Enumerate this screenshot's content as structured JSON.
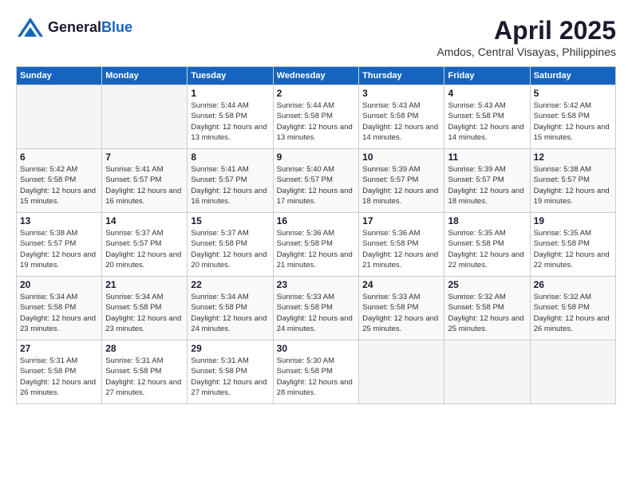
{
  "header": {
    "logo_general": "General",
    "logo_blue": "Blue",
    "month_title": "April 2025",
    "location": "Amdos, Central Visayas, Philippines"
  },
  "weekdays": [
    "Sunday",
    "Monday",
    "Tuesday",
    "Wednesday",
    "Thursday",
    "Friday",
    "Saturday"
  ],
  "weeks": [
    [
      {
        "day": "",
        "sunrise": "",
        "sunset": "",
        "daylight": ""
      },
      {
        "day": "",
        "sunrise": "",
        "sunset": "",
        "daylight": ""
      },
      {
        "day": "1",
        "sunrise": "Sunrise: 5:44 AM",
        "sunset": "Sunset: 5:58 PM",
        "daylight": "Daylight: 12 hours and 13 minutes."
      },
      {
        "day": "2",
        "sunrise": "Sunrise: 5:44 AM",
        "sunset": "Sunset: 5:58 PM",
        "daylight": "Daylight: 12 hours and 13 minutes."
      },
      {
        "day": "3",
        "sunrise": "Sunrise: 5:43 AM",
        "sunset": "Sunset: 5:58 PM",
        "daylight": "Daylight: 12 hours and 14 minutes."
      },
      {
        "day": "4",
        "sunrise": "Sunrise: 5:43 AM",
        "sunset": "Sunset: 5:58 PM",
        "daylight": "Daylight: 12 hours and 14 minutes."
      },
      {
        "day": "5",
        "sunrise": "Sunrise: 5:42 AM",
        "sunset": "Sunset: 5:58 PM",
        "daylight": "Daylight: 12 hours and 15 minutes."
      }
    ],
    [
      {
        "day": "6",
        "sunrise": "Sunrise: 5:42 AM",
        "sunset": "Sunset: 5:58 PM",
        "daylight": "Daylight: 12 hours and 15 minutes."
      },
      {
        "day": "7",
        "sunrise": "Sunrise: 5:41 AM",
        "sunset": "Sunset: 5:57 PM",
        "daylight": "Daylight: 12 hours and 16 minutes."
      },
      {
        "day": "8",
        "sunrise": "Sunrise: 5:41 AM",
        "sunset": "Sunset: 5:57 PM",
        "daylight": "Daylight: 12 hours and 16 minutes."
      },
      {
        "day": "9",
        "sunrise": "Sunrise: 5:40 AM",
        "sunset": "Sunset: 5:57 PM",
        "daylight": "Daylight: 12 hours and 17 minutes."
      },
      {
        "day": "10",
        "sunrise": "Sunrise: 5:39 AM",
        "sunset": "Sunset: 5:57 PM",
        "daylight": "Daylight: 12 hours and 18 minutes."
      },
      {
        "day": "11",
        "sunrise": "Sunrise: 5:39 AM",
        "sunset": "Sunset: 5:57 PM",
        "daylight": "Daylight: 12 hours and 18 minutes."
      },
      {
        "day": "12",
        "sunrise": "Sunrise: 5:38 AM",
        "sunset": "Sunset: 5:57 PM",
        "daylight": "Daylight: 12 hours and 19 minutes."
      }
    ],
    [
      {
        "day": "13",
        "sunrise": "Sunrise: 5:38 AM",
        "sunset": "Sunset: 5:57 PM",
        "daylight": "Daylight: 12 hours and 19 minutes."
      },
      {
        "day": "14",
        "sunrise": "Sunrise: 5:37 AM",
        "sunset": "Sunset: 5:57 PM",
        "daylight": "Daylight: 12 hours and 20 minutes."
      },
      {
        "day": "15",
        "sunrise": "Sunrise: 5:37 AM",
        "sunset": "Sunset: 5:58 PM",
        "daylight": "Daylight: 12 hours and 20 minutes."
      },
      {
        "day": "16",
        "sunrise": "Sunrise: 5:36 AM",
        "sunset": "Sunset: 5:58 PM",
        "daylight": "Daylight: 12 hours and 21 minutes."
      },
      {
        "day": "17",
        "sunrise": "Sunrise: 5:36 AM",
        "sunset": "Sunset: 5:58 PM",
        "daylight": "Daylight: 12 hours and 21 minutes."
      },
      {
        "day": "18",
        "sunrise": "Sunrise: 5:35 AM",
        "sunset": "Sunset: 5:58 PM",
        "daylight": "Daylight: 12 hours and 22 minutes."
      },
      {
        "day": "19",
        "sunrise": "Sunrise: 5:35 AM",
        "sunset": "Sunset: 5:58 PM",
        "daylight": "Daylight: 12 hours and 22 minutes."
      }
    ],
    [
      {
        "day": "20",
        "sunrise": "Sunrise: 5:34 AM",
        "sunset": "Sunset: 5:58 PM",
        "daylight": "Daylight: 12 hours and 23 minutes."
      },
      {
        "day": "21",
        "sunrise": "Sunrise: 5:34 AM",
        "sunset": "Sunset: 5:58 PM",
        "daylight": "Daylight: 12 hours and 23 minutes."
      },
      {
        "day": "22",
        "sunrise": "Sunrise: 5:34 AM",
        "sunset": "Sunset: 5:58 PM",
        "daylight": "Daylight: 12 hours and 24 minutes."
      },
      {
        "day": "23",
        "sunrise": "Sunrise: 5:33 AM",
        "sunset": "Sunset: 5:58 PM",
        "daylight": "Daylight: 12 hours and 24 minutes."
      },
      {
        "day": "24",
        "sunrise": "Sunrise: 5:33 AM",
        "sunset": "Sunset: 5:58 PM",
        "daylight": "Daylight: 12 hours and 25 minutes."
      },
      {
        "day": "25",
        "sunrise": "Sunrise: 5:32 AM",
        "sunset": "Sunset: 5:58 PM",
        "daylight": "Daylight: 12 hours and 25 minutes."
      },
      {
        "day": "26",
        "sunrise": "Sunrise: 5:32 AM",
        "sunset": "Sunset: 5:58 PM",
        "daylight": "Daylight: 12 hours and 26 minutes."
      }
    ],
    [
      {
        "day": "27",
        "sunrise": "Sunrise: 5:31 AM",
        "sunset": "Sunset: 5:58 PM",
        "daylight": "Daylight: 12 hours and 26 minutes."
      },
      {
        "day": "28",
        "sunrise": "Sunrise: 5:31 AM",
        "sunset": "Sunset: 5:58 PM",
        "daylight": "Daylight: 12 hours and 27 minutes."
      },
      {
        "day": "29",
        "sunrise": "Sunrise: 5:31 AM",
        "sunset": "Sunset: 5:58 PM",
        "daylight": "Daylight: 12 hours and 27 minutes."
      },
      {
        "day": "30",
        "sunrise": "Sunrise: 5:30 AM",
        "sunset": "Sunset: 5:58 PM",
        "daylight": "Daylight: 12 hours and 28 minutes."
      },
      {
        "day": "",
        "sunrise": "",
        "sunset": "",
        "daylight": ""
      },
      {
        "day": "",
        "sunrise": "",
        "sunset": "",
        "daylight": ""
      },
      {
        "day": "",
        "sunrise": "",
        "sunset": "",
        "daylight": ""
      }
    ]
  ]
}
